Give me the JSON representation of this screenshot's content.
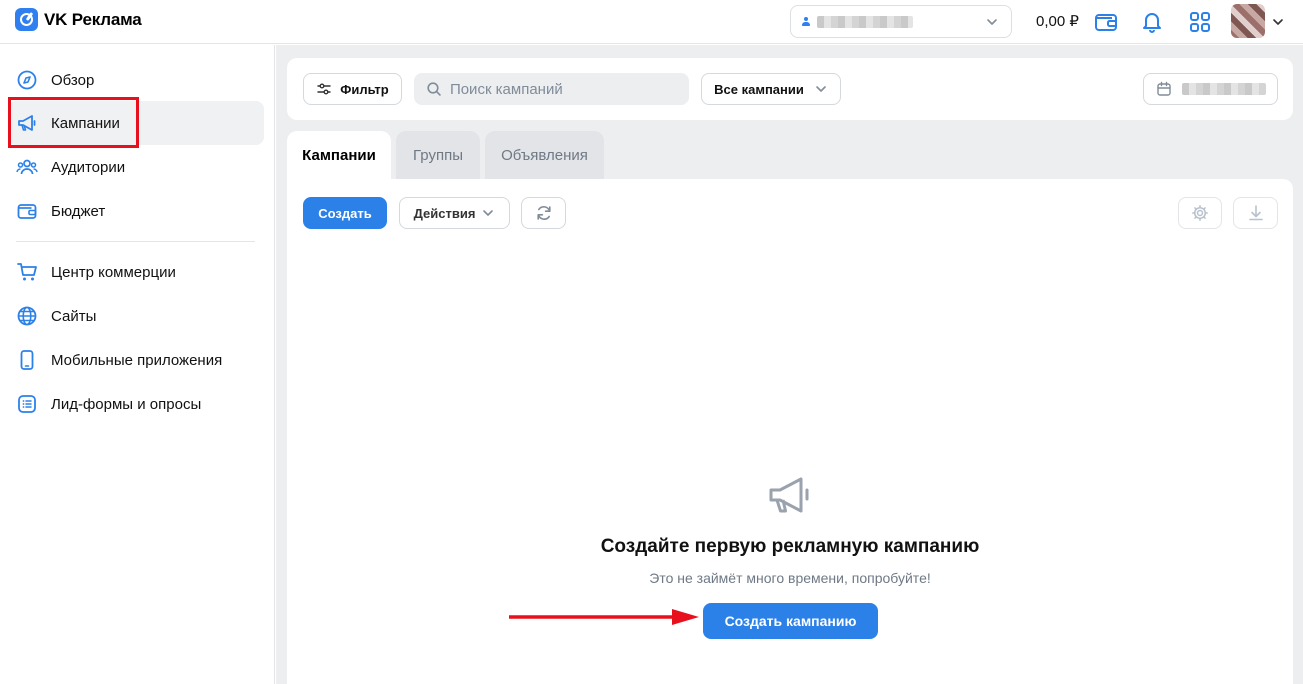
{
  "header": {
    "logo_text": "VK Реклама",
    "balance": "0,00 ₽"
  },
  "sidebar": {
    "items": [
      {
        "label": "Обзор",
        "icon": "compass-icon"
      },
      {
        "label": "Кампании",
        "icon": "megaphone-icon",
        "active": true
      },
      {
        "label": "Аудитории",
        "icon": "users-icon"
      },
      {
        "label": "Бюджет",
        "icon": "wallet-icon"
      },
      {
        "label": "Центр коммерции",
        "icon": "cart-icon"
      },
      {
        "label": "Сайты",
        "icon": "globe-icon"
      },
      {
        "label": "Мобильные приложения",
        "icon": "phone-icon"
      },
      {
        "label": "Лид-формы и опросы",
        "icon": "list-form-icon"
      }
    ]
  },
  "filter_bar": {
    "filter_label": "Фильтр",
    "search_placeholder": "Поиск кампаний",
    "campaign_select": "Все кампании"
  },
  "tabs": [
    {
      "label": "Кампании",
      "active": true
    },
    {
      "label": "Группы",
      "active": false
    },
    {
      "label": "Объявления",
      "active": false
    }
  ],
  "toolbar": {
    "create_label": "Создать",
    "actions_label": "Действия"
  },
  "empty_state": {
    "title": "Создайте первую рекламную кампанию",
    "subtitle": "Это не займёт много времени, попробуйте!",
    "cta_label": "Создать кампанию"
  },
  "colors": {
    "accent": "#2c81e9",
    "highlight": "#e8101c",
    "background": "#edeef0"
  }
}
